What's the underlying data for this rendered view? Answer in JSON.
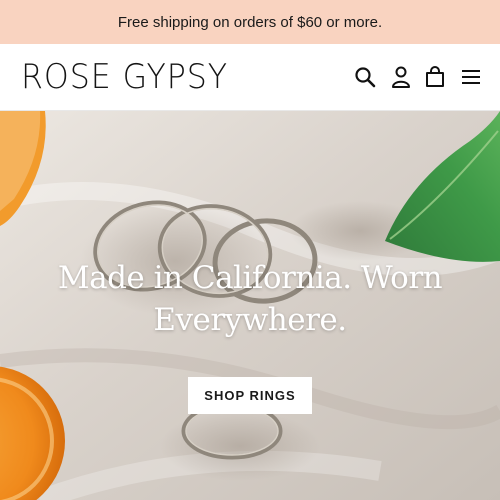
{
  "announcement": {
    "text": "Free shipping on orders of $60 or more.",
    "background_color": "#f9d3c0"
  },
  "header": {
    "logo_text": "ROSE GYPSY",
    "icons": [
      "search-icon",
      "account-icon",
      "cart-icon",
      "menu-icon"
    ]
  },
  "hero": {
    "headline": "Made in California. Worn Everywhere.",
    "cta_label": "SHOP RINGS"
  }
}
